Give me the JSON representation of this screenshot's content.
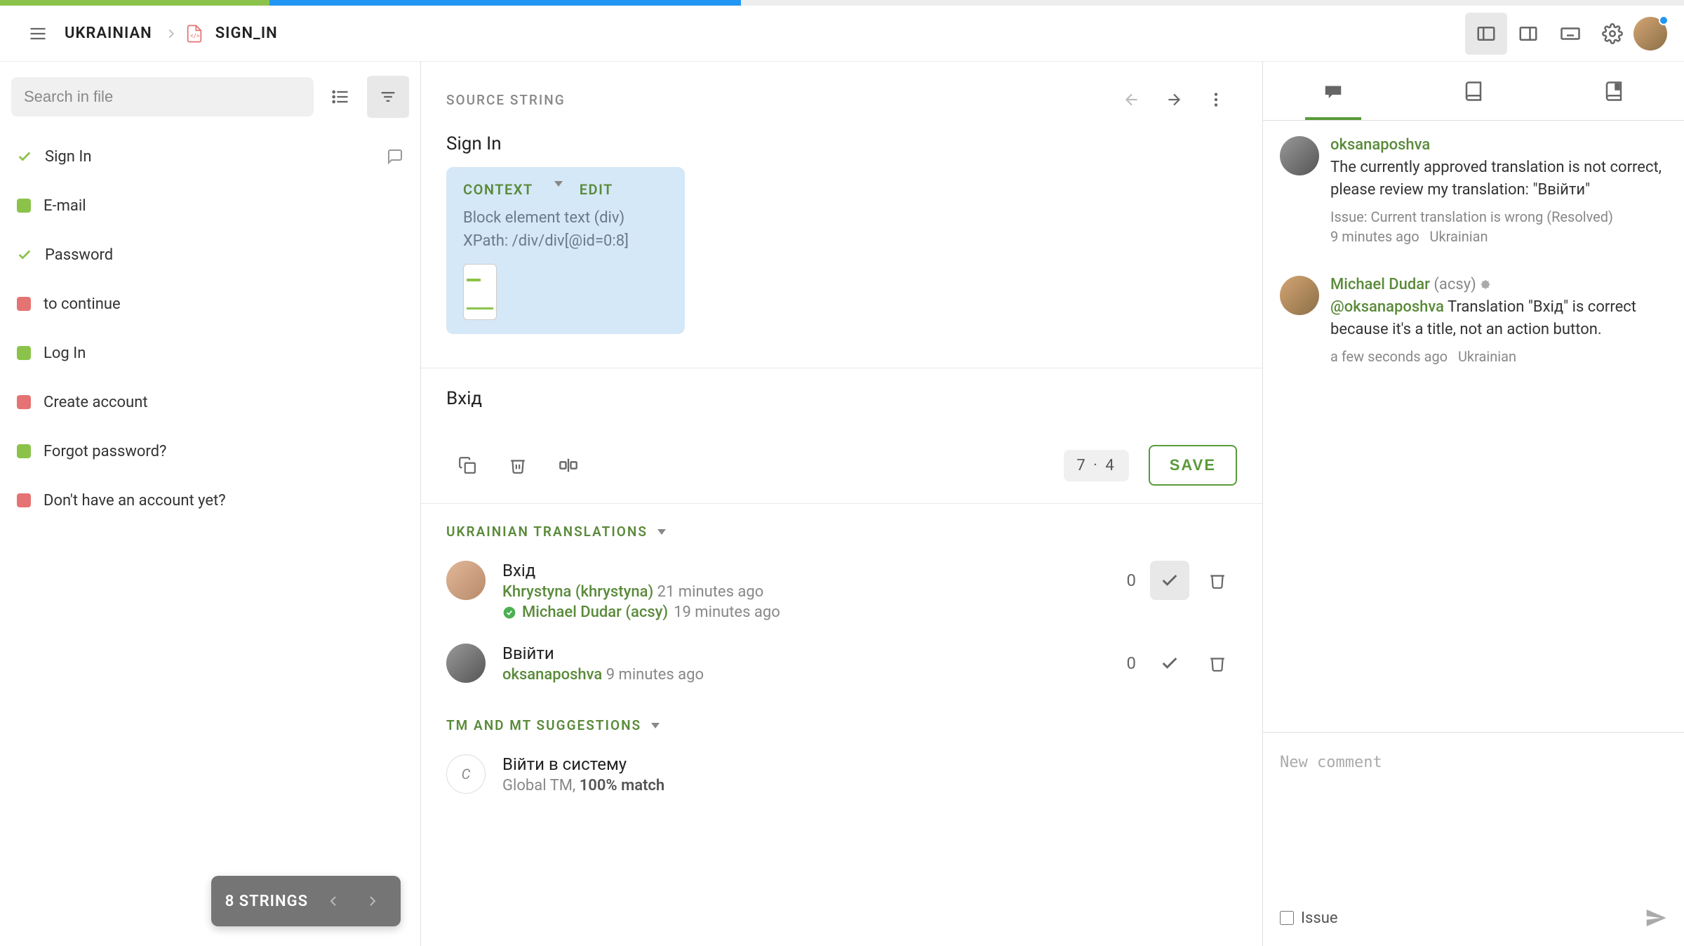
{
  "header": {
    "breadcrumb_lang": "UKRAINIAN",
    "breadcrumb_file": "SIGN_IN"
  },
  "left": {
    "search_placeholder": "Search in file",
    "items": [
      {
        "status": "check",
        "label": "Sign In",
        "has_comment": true,
        "selected": true
      },
      {
        "status": "green",
        "label": "E-mail"
      },
      {
        "status": "check",
        "label": "Password"
      },
      {
        "status": "red",
        "label": "to continue"
      },
      {
        "status": "green",
        "label": "Log In"
      },
      {
        "status": "red",
        "label": "Create account"
      },
      {
        "status": "green",
        "label": "Forgot password?"
      },
      {
        "status": "red",
        "label": "Don't have an account yet?"
      }
    ],
    "pill": "8 STRINGS"
  },
  "center": {
    "source_label": "SOURCE STRING",
    "source_text_a": "Sign ",
    "source_text_b": "In",
    "context_label": "CONTEXT",
    "edit_label": "EDIT",
    "context_line1": "Block element text (div)",
    "context_line2": "XPath: /div/div[@id=0:8]",
    "translation_value": "Вхід",
    "char_meta": "7  ·  4",
    "save_label": "SAVE",
    "translations_header": "UKRAINIAN TRANSLATIONS",
    "suggestions": [
      {
        "text": "Вхід",
        "author": "Khrystyna (khrystyna)",
        "when": "21 minutes ago",
        "approver": "Michael Dudar (acsy)",
        "approved_when": "19 minutes ago",
        "score": "0",
        "approved": true
      },
      {
        "text": "Ввійти",
        "author": "oksanaposhva",
        "when": "9 minutes ago",
        "score": "0",
        "approved": false
      }
    ],
    "tm_header": "TM AND MT SUGGESTIONS",
    "tm_suggestion": {
      "text": "Війти в систему",
      "source": "Global TM, ",
      "match": "100% match"
    }
  },
  "right": {
    "comments": [
      {
        "author": "oksanaposhva",
        "handle": "",
        "text": "The currently approved translation is not correct, please review my translation: \"Ввійти\"",
        "mention": "",
        "issue": "Issue: Current translation is wrong (Resolved)",
        "when": "9 minutes ago",
        "lang": "Ukrainian"
      },
      {
        "author": "Michael Dudar",
        "handle": "(acsy)",
        "mention": "@oksanaposhva",
        "text": "Translation \"Вхід\" is correct because it's a title, not an action button.",
        "issue": "",
        "when": "a few seconds ago",
        "lang": "Ukrainian"
      }
    ],
    "new_comment_placeholder": "New comment",
    "issue_label": "Issue"
  }
}
